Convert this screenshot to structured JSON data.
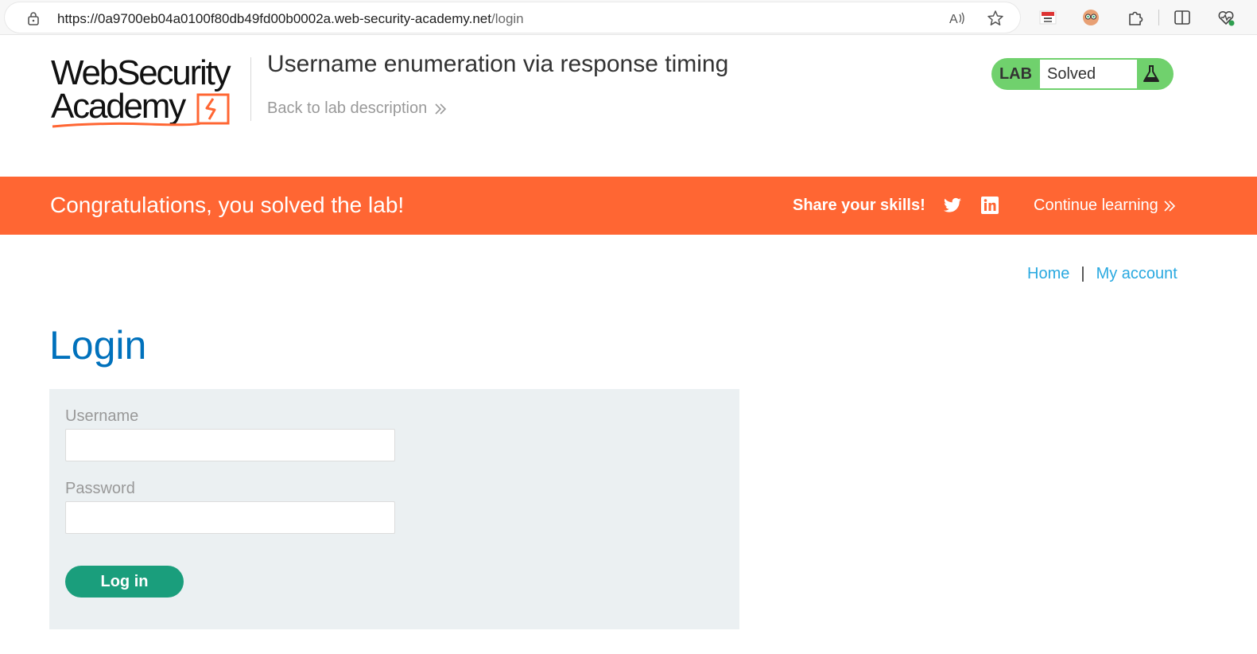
{
  "browser": {
    "url_host": "https://0a9700eb04a0100f80db49fd00b0002a.web-security-academy.net",
    "url_path": "/login",
    "icons": [
      "lock-icon",
      "read-aloud-icon",
      "favorite-star-icon",
      "flag-extension-icon",
      "avatar-extension-icon",
      "extensions-puzzle-icon",
      "split-screen-icon",
      "browser-essentials-icon"
    ]
  },
  "header": {
    "logo_line1": "WebSecurity",
    "logo_line2": "Academy",
    "lab_title": "Username enumeration via response timing",
    "back_link": "Back to lab description",
    "lab_tag": "LAB",
    "lab_state": "Solved",
    "colors": {
      "status_green": "#70d16d",
      "logo_orange": "#ff6633"
    }
  },
  "banner": {
    "message": "Congratulations, you solved the lab!",
    "share_label": "Share your skills!",
    "continue_link": "Continue learning",
    "color": "#ff6633"
  },
  "nav": {
    "home": "Home",
    "separator": "|",
    "my_account": "My account"
  },
  "login": {
    "title": "Login",
    "username_label": "Username",
    "username_value": "",
    "password_label": "Password",
    "password_value": "",
    "submit_label": "Log in",
    "colors": {
      "title_blue": "#0071bc",
      "button_green": "#1a9e7c",
      "panel_bg": "#ebf0f2"
    }
  }
}
